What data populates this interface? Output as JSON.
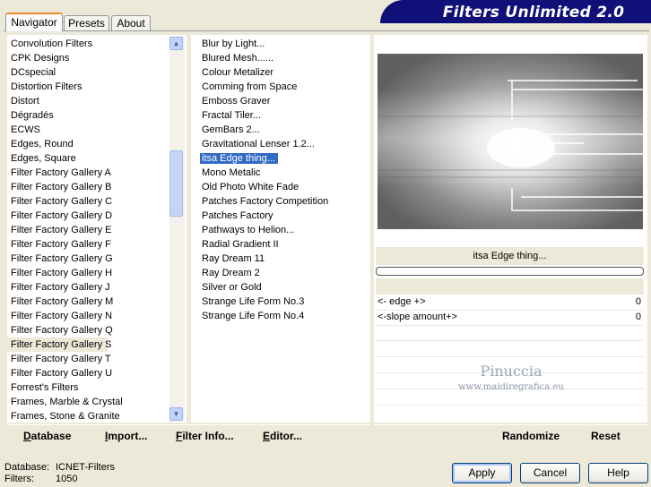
{
  "tabs": [
    "Navigator",
    "Presets",
    "About"
  ],
  "banner_title": "Filters Unlimited 2.0",
  "categories": [
    "Convolution Filters",
    "CPK Designs",
    "DCspecial",
    "Distortion Filters",
    "Distort",
    "Dégradés",
    "ECWS",
    "Edges, Round",
    "Edges, Square",
    "Filter Factory Gallery A",
    "Filter Factory Gallery B",
    "Filter Factory Gallery C",
    "Filter Factory Gallery D",
    "Filter Factory Gallery E",
    "Filter Factory Gallery F",
    "Filter Factory Gallery G",
    "Filter Factory Gallery H",
    "Filter Factory Gallery J",
    "Filter Factory Gallery M",
    "Filter Factory Gallery N",
    "Filter Factory Gallery Q",
    "Filter Factory Gallery S",
    "Filter Factory Gallery T",
    "Filter Factory Gallery U",
    "Forrest's Filters",
    "Frames, Marble & Crystal",
    "Frames, Stone & Granite"
  ],
  "selected_category": "Filter Factory Gallery S",
  "filters": [
    "Blur by Light...",
    "Blured Mesh......",
    "Colour Metalizer",
    "Comming from Space",
    "Emboss Graver",
    "Fractal Tiler...",
    "GemBars 2...",
    "Gravitational Lenser 1.2...",
    "itsa Edge thing...",
    "Mono Metalic",
    "Old Photo White Fade",
    "Patches Factory Competition",
    "Patches Factory",
    "Pathways to Helion...",
    "Radial Gradient II",
    "Ray Dream 11",
    "Ray Dream 2",
    "Silver or Gold",
    "Strange Life Form No.3",
    "Strange Life Form No.4"
  ],
  "selected_filter": "itsa Edge thing...",
  "preview_filter_name": "itsa Edge thing...",
  "params": [
    {
      "label": "<- edge +>",
      "value": "0"
    },
    {
      "label": "<-slope amount+>",
      "value": "0"
    }
  ],
  "watermark": {
    "line1": "Pinuccia",
    "line2": "www.maidiregrafica.eu"
  },
  "toolbar": {
    "database": "Database",
    "import": "Import...",
    "filter_info": "Filter Info...",
    "editor": "Editor...",
    "randomize": "Randomize",
    "reset": "Reset"
  },
  "status": {
    "database_label": "Database:",
    "database_value": "ICNET-Filters",
    "filters_label": "Filters:",
    "filters_value": "1050"
  },
  "buttons": {
    "apply": "Apply",
    "cancel": "Cancel",
    "help": "Help"
  },
  "colors": {
    "banner": "#101078",
    "selection": "#316ac5",
    "window": "#ece9d8"
  }
}
